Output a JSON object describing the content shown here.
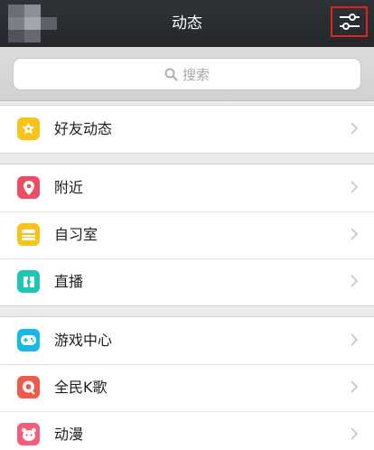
{
  "header": {
    "title": "动态",
    "settings_icon": "settings-sliders-icon"
  },
  "search": {
    "placeholder": "搜索",
    "icon": "search-icon"
  },
  "groups": [
    {
      "items": [
        {
          "label": "好友动态",
          "icon": "friends-star-icon",
          "color": "#f7c21c"
        }
      ]
    },
    {
      "items": [
        {
          "label": "附近",
          "icon": "location-pin-icon",
          "color": "#ec4d63"
        },
        {
          "label": "自习室",
          "icon": "study-room-icon",
          "color": "#f7c21c"
        },
        {
          "label": "直播",
          "icon": "live-broadcast-icon",
          "color": "#1ec6b3"
        }
      ]
    },
    {
      "items": [
        {
          "label": "游戏中心",
          "icon": "gamepad-icon",
          "color": "#18b8e8"
        },
        {
          "label": "全民K歌",
          "icon": "karaoke-icon",
          "color": "#ee5a4c"
        },
        {
          "label": "动漫",
          "icon": "anime-icon",
          "color": "#f15d7a"
        }
      ]
    }
  ],
  "colors": {
    "titlebar": "#2a2d31",
    "highlight": "#e0231c",
    "background": "#ebebeb"
  }
}
